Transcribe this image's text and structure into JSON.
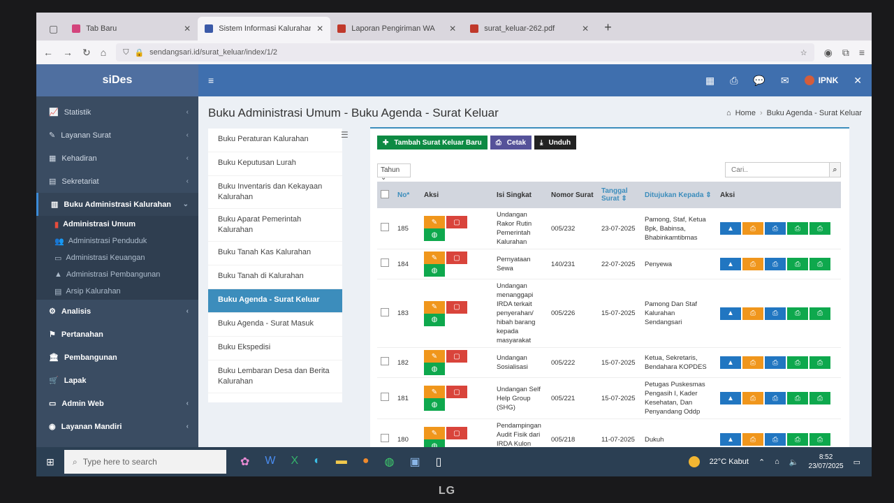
{
  "browser": {
    "tabs": [
      {
        "label": "Tab Baru",
        "color": "#d3447c"
      },
      {
        "label": "Sistem Informasi Kalurahan Sen",
        "color": "#3b5aa8"
      },
      {
        "label": "Laporan Pengiriman WA",
        "color": "#c0392b"
      },
      {
        "label": "surat_keluar-262.pdf",
        "color": "#c0392b"
      }
    ],
    "url": "sendangsari.id/surat_keluar/index/1/2"
  },
  "app": {
    "logo": "siDes",
    "user": "IPNK"
  },
  "sidebar": {
    "items": [
      {
        "icon": "📈",
        "label": "Statistik",
        "chev": "‹"
      },
      {
        "icon": "✎",
        "label": "Layanan Surat",
        "chev": "‹"
      },
      {
        "icon": "▦",
        "label": "Kehadiran",
        "chev": "‹"
      },
      {
        "icon": "▤",
        "label": "Sekretariat",
        "chev": "‹"
      },
      {
        "icon": "▥",
        "label": "Buku Administrasi Kalurahan",
        "chev": "⌄"
      }
    ],
    "subitems": [
      {
        "icon": "▮",
        "label": "Administrasi Umum"
      },
      {
        "icon": "👥",
        "label": "Administrasi Penduduk"
      },
      {
        "icon": "▭",
        "label": "Administrasi Keuangan"
      },
      {
        "icon": "▲",
        "label": "Administrasi Pembangunan"
      },
      {
        "icon": "▤",
        "label": "Arsip Kalurahan"
      }
    ],
    "items2": [
      {
        "icon": "⚙",
        "label": "Analisis",
        "chev": "‹"
      },
      {
        "icon": "⚑",
        "label": "Pertanahan",
        "chev": ""
      },
      {
        "icon": "🏛",
        "label": "Pembangunan",
        "chev": ""
      },
      {
        "icon": "🛒",
        "label": "Lapak",
        "chev": ""
      },
      {
        "icon": "▭",
        "label": "Admin Web",
        "chev": "‹"
      },
      {
        "icon": "◉",
        "label": "Layanan Mandiri",
        "chev": "‹"
      }
    ]
  },
  "page": {
    "title": "Buku Administrasi Umum - Buku Agenda - Surat Keluar",
    "breadcrumb_home": "Home",
    "breadcrumb_current": "Buku Agenda - Surat Keluar"
  },
  "bookmenu": [
    "Buku Peraturan Kalurahan",
    "Buku Keputusan Lurah",
    "Buku Inventaris dan Kekayaan Kalurahan",
    "Buku Aparat Pemerintah Kalurahan",
    "Buku Tanah Kas Kalurahan",
    "Buku Tanah di Kalurahan",
    "Buku Agenda - Surat Keluar",
    "Buku Agenda - Surat Masuk",
    "Buku Ekspedisi",
    "Buku Lembaran Desa dan Berita Kalurahan"
  ],
  "toolbar": {
    "add": "Tambah Surat Keluar Baru",
    "print": "Cetak",
    "download": "Unduh",
    "year": "Tahun",
    "search_placeholder": "Cari.."
  },
  "table": {
    "headers": [
      "No",
      "Aksi",
      "Isi Singkat",
      "Nomor Surat",
      "Tanggal Surat",
      "Ditujukan Kepada",
      "Aksi"
    ],
    "rows": [
      {
        "no": "185",
        "isi": "Undangan Rakor Rutin Pemerintah Kalurahan",
        "nomor": "005/232",
        "tanggal": "23-07-2025",
        "tujuan": "Pamong, Staf, Ketua Bpk, Babinsa, Bhabinkamtibmas"
      },
      {
        "no": "184",
        "isi": "Pernyataan Sewa",
        "nomor": "140/231",
        "tanggal": "22-07-2025",
        "tujuan": "Penyewa"
      },
      {
        "no": "183",
        "isi": "Undangan menanggapi IRDA terkait penyerahan/ hibah barang kepada masyarakat",
        "nomor": "005/226",
        "tanggal": "15-07-2025",
        "tujuan": "Pamong Dan Staf Kalurahan Sendangsari"
      },
      {
        "no": "182",
        "isi": "Undangan Sosialisasi",
        "nomor": "005/222",
        "tanggal": "15-07-2025",
        "tujuan": "Ketua, Sekretaris, Bendahara KOPDES"
      },
      {
        "no": "181",
        "isi": "Undangan Self Help Group (SHG)",
        "nomor": "005/221",
        "tanggal": "15-07-2025",
        "tujuan": "Petugas Puskesmas Pengasih I, Kader Kesehatan, Dan Penyandang Oddp"
      },
      {
        "no": "180",
        "isi": "Pendampingan Audit Fisik dari IRDA Kulon Progo",
        "nomor": "005/218",
        "tanggal": "11-07-2025",
        "tujuan": "Dukuh"
      }
    ]
  },
  "taskbar": {
    "search": "Type here to search",
    "weather": "22°C Kabut",
    "time": "8:52",
    "date": "23/07/2025"
  },
  "monitor_brand": "LG"
}
